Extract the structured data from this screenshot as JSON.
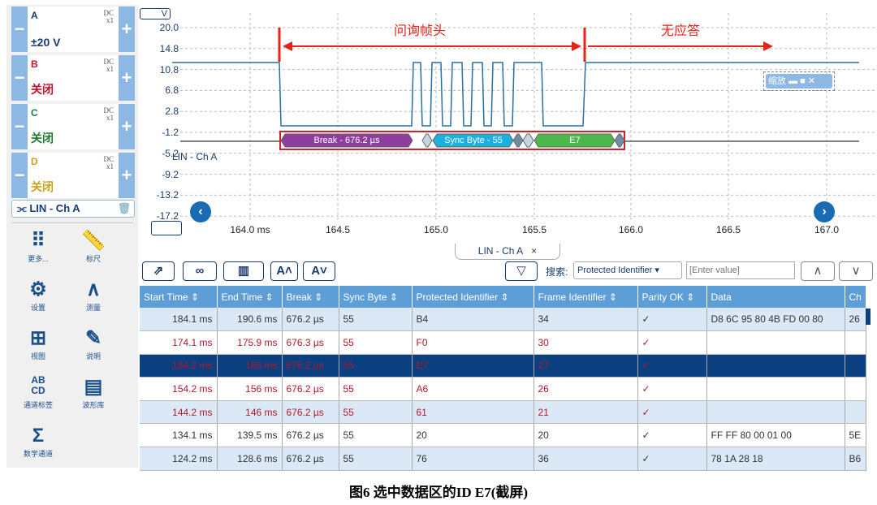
{
  "channels": [
    {
      "name": "A",
      "coupling": "DC",
      "probe": "x1",
      "status": "±20 V",
      "color": "#1b3c6b"
    },
    {
      "name": "B",
      "coupling": "DC",
      "probe": "x1",
      "status": "关闭",
      "color": "#c8102e"
    },
    {
      "name": "C",
      "coupling": "DC",
      "probe": "x1",
      "status": "关闭",
      "color": "#1e7b34"
    },
    {
      "name": "D",
      "coupling": "DC",
      "probe": "x1",
      "status": "关闭",
      "color": "#c9a21a"
    }
  ],
  "decoder": {
    "label": "LIN - Ch A"
  },
  "tools": [
    {
      "icon": "⠿",
      "label": "更多..."
    },
    {
      "icon": "📏",
      "label": "标尺"
    },
    {
      "icon": "⚙",
      "label": "设置"
    },
    {
      "icon": "∧",
      "label": "测量"
    },
    {
      "icon": "⊞",
      "label": "视图"
    },
    {
      "icon": "✎",
      "label": "说明"
    },
    {
      "icon": "AB CD",
      "label": "通道标签"
    },
    {
      "icon": "▤",
      "label": "波形库"
    },
    {
      "icon": "Σ",
      "label": "数学通道"
    }
  ],
  "plot": {
    "unit": "V",
    "y_ticks": [
      "20.0",
      "14.8",
      "10.8",
      "6.8",
      "2.8",
      "-1.2",
      "-5.2",
      "-9.2",
      "-13.2",
      "-17.2"
    ],
    "x_ticks": [
      "164.0 ms",
      "164.5",
      "165.0",
      "165.5",
      "166.0",
      "166.5",
      "167.0"
    ],
    "channel_label": "LIN - Ch A",
    "decode": {
      "break": "Break - 676.2 µs",
      "sync": "Sync Byte - 55",
      "pid": "E7"
    },
    "annotations": {
      "header": "问询帧头",
      "no_response": "无应答"
    },
    "zoom_label": "缩放",
    "trace_color": "#2a6f9e"
  },
  "table_panel": {
    "tab": "LIN - Ch A",
    "tab_close": "×",
    "search_label": "搜索:",
    "search_field": "Protected Identifier",
    "search_placeholder": "[Enter value]",
    "columns": [
      "Start Time ⇕",
      "End Time ⇕",
      "Break ⇕",
      "Sync Byte ⇕",
      "Protected Identifier ⇕",
      "Frame Identifier ⇕",
      "Parity OK ⇕",
      "Data",
      "Ch"
    ],
    "rows": [
      [
        "184.1 ms",
        "190.6 ms",
        "676.2 µs",
        "55",
        "B4",
        "34",
        "✓",
        "D8 6C 95 80 4B FD 00 80",
        "26"
      ],
      [
        "174.1 ms",
        "175.9 ms",
        "676.3 µs",
        "55",
        "F0",
        "30",
        "✓",
        "",
        ""
      ],
      [
        "164.2 ms",
        "166 ms",
        "676.2 µs",
        "55",
        "E7",
        "27",
        "✓",
        "",
        ""
      ],
      [
        "154.2 ms",
        "156 ms",
        "676.2 µs",
        "55",
        "A6",
        "26",
        "✓",
        "",
        ""
      ],
      [
        "144.2 ms",
        "146 ms",
        "676.2 µs",
        "55",
        "61",
        "21",
        "✓",
        "",
        ""
      ],
      [
        "134.1 ms",
        "139.5 ms",
        "676.2 µs",
        "55",
        "20",
        "20",
        "✓",
        "FF FF 80 00 01 00",
        "5E"
      ],
      [
        "124.2 ms",
        "128.6 ms",
        "676.2 µs",
        "55",
        "76",
        "36",
        "✓",
        "78 1A 28 18",
        "B6"
      ]
    ],
    "selected_row": 2
  },
  "caption": "图6  选中数据区的ID E7(截屏)"
}
